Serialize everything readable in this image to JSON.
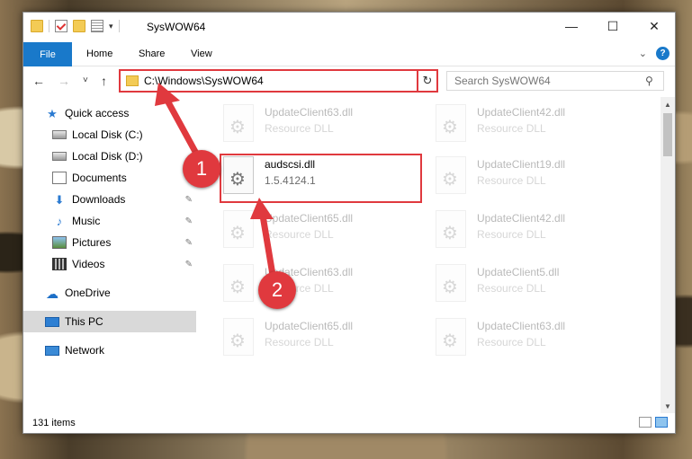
{
  "window": {
    "title": "SysWOW64",
    "controls": {
      "minimize": "—",
      "maximize": "☐",
      "close": "✕"
    }
  },
  "ribbon": {
    "tabs": [
      "File",
      "Home",
      "Share",
      "View"
    ],
    "help": "?"
  },
  "navigation": {
    "back": "←",
    "forward": "→",
    "recent": "˅",
    "up": "↑",
    "address": "C:\\Windows\\SysWOW64",
    "refresh": "↻",
    "search_placeholder": "Search SysWOW64"
  },
  "sidebar": {
    "items": [
      {
        "label": "Quick access",
        "icon": "star-icon"
      },
      {
        "label": "Local Disk (C:)",
        "icon": "disk-icon"
      },
      {
        "label": "Local Disk (D:)",
        "icon": "disk-icon"
      },
      {
        "label": "Documents",
        "icon": "documents-icon"
      },
      {
        "label": "Downloads",
        "icon": "download-icon"
      },
      {
        "label": "Music",
        "icon": "music-icon"
      },
      {
        "label": "Pictures",
        "icon": "pictures-icon"
      },
      {
        "label": "Videos",
        "icon": "videos-icon"
      },
      {
        "label": "OneDrive",
        "icon": "cloud-icon"
      },
      {
        "label": "This PC",
        "icon": "pc-icon"
      },
      {
        "label": "Network",
        "icon": "network-icon"
      }
    ]
  },
  "files": [
    {
      "name": "UpdateClient63.dll",
      "desc": "Resource DLL"
    },
    {
      "name": "UpdateClient42.dll",
      "desc": "Resource DLL"
    },
    {
      "name": "audscsi.dll",
      "desc": "1.5.4124.1"
    },
    {
      "name": "UpdateClient19.dll",
      "desc": "Resource DLL"
    },
    {
      "name": "UpdateClient65.dll",
      "desc": "Resource DLL"
    },
    {
      "name": "UpdateClient42.dll",
      "desc": "Resource DLL"
    },
    {
      "name": "UpdateClient63.dll",
      "desc": "Resource DLL"
    },
    {
      "name": "UpdateClient5.dll",
      "desc": "Resource DLL"
    },
    {
      "name": "UpdateClient65.dll",
      "desc": "Resource DLL"
    },
    {
      "name": "UpdateClient63.dll",
      "desc": "Resource DLL"
    }
  ],
  "status": {
    "item_count": "131 items"
  },
  "annotations": {
    "step1": "1",
    "step2": "2"
  },
  "colors": {
    "accent": "#1979ca",
    "annotation": "#e0393e",
    "selected": "#d9d9d9"
  }
}
